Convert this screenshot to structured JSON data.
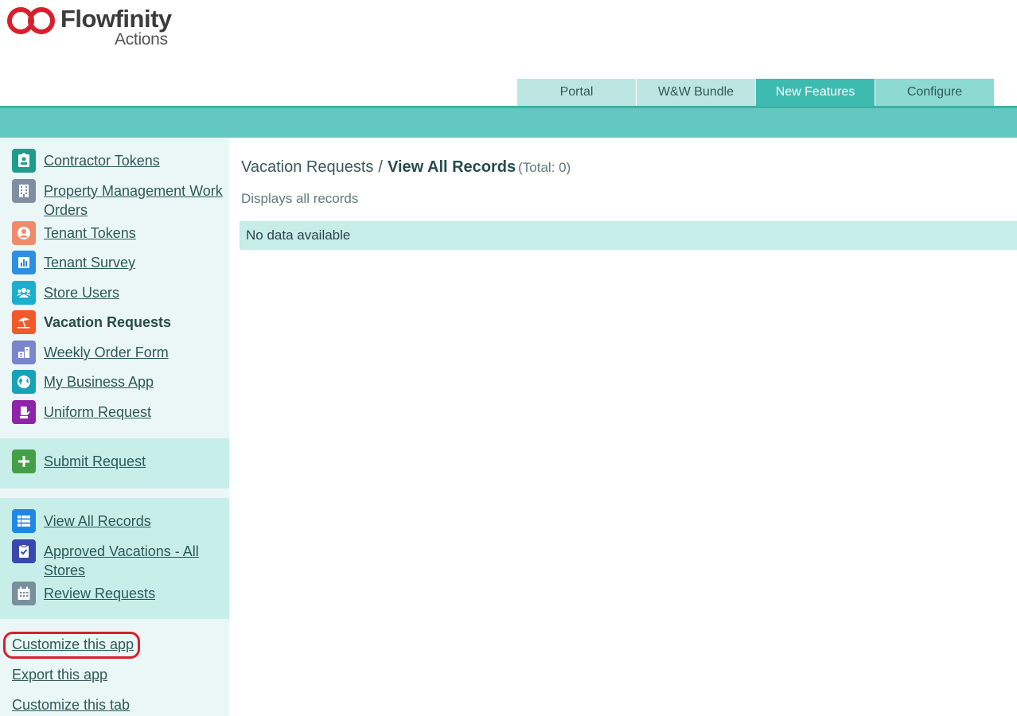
{
  "brand": {
    "name": "Flowfinity",
    "product": "Actions",
    "accent": "#d6202c"
  },
  "top_tabs": [
    {
      "label": "Portal",
      "active": false
    },
    {
      "label": "W&W Bundle",
      "active": false
    },
    {
      "label": "New Features",
      "active": true
    },
    {
      "label": "Configure",
      "active": false
    }
  ],
  "sidebar": {
    "apps": [
      {
        "label": "Contractor Tokens",
        "icon": "id-badge-icon",
        "color": "#1e9b8c"
      },
      {
        "label": "Property Management Work Orders",
        "icon": "building-icon",
        "color": "#7f8ea3"
      },
      {
        "label": "Tenant Tokens",
        "icon": "user-circle-icon",
        "color": "#f08a6a"
      },
      {
        "label": "Tenant Survey",
        "icon": "bar-chart-icon",
        "color": "#2e8ee0"
      },
      {
        "label": "Store Users",
        "icon": "users-icon",
        "color": "#1ab0cc"
      },
      {
        "label": "Vacation Requests",
        "icon": "beach-umbrella-icon",
        "color": "#f2592a",
        "current": true
      },
      {
        "label": "Weekly Order Form",
        "icon": "order-form-icon",
        "color": "#7986cb"
      },
      {
        "label": "My Business App",
        "icon": "globe-icon",
        "color": "#17a2b8"
      },
      {
        "label": "Uniform Request",
        "icon": "mitten-icon",
        "color": "#8e24aa"
      }
    ],
    "actions": [
      {
        "label": "Submit Request",
        "icon": "plus-icon",
        "color": "#43a047"
      }
    ],
    "views": [
      {
        "label": "View All Records",
        "icon": "list-icon",
        "color": "#1e88e5"
      },
      {
        "label": "Approved Vacations - All Stores",
        "icon": "clipboard-check-icon",
        "color": "#3949ab"
      },
      {
        "label": "Review Requests",
        "icon": "calendar-icon",
        "color": "#78909c"
      }
    ],
    "links": [
      {
        "label": "Customize this app",
        "highlighted": true
      },
      {
        "label": "Export this app"
      },
      {
        "label": "Customize this tab"
      }
    ]
  },
  "main": {
    "breadcrumb_parent": "Vacation Requests",
    "breadcrumb_separator": "/",
    "breadcrumb_current": "View All Records",
    "total": "(Total: 0)",
    "description": "Displays all records",
    "empty_message": "No data available"
  }
}
